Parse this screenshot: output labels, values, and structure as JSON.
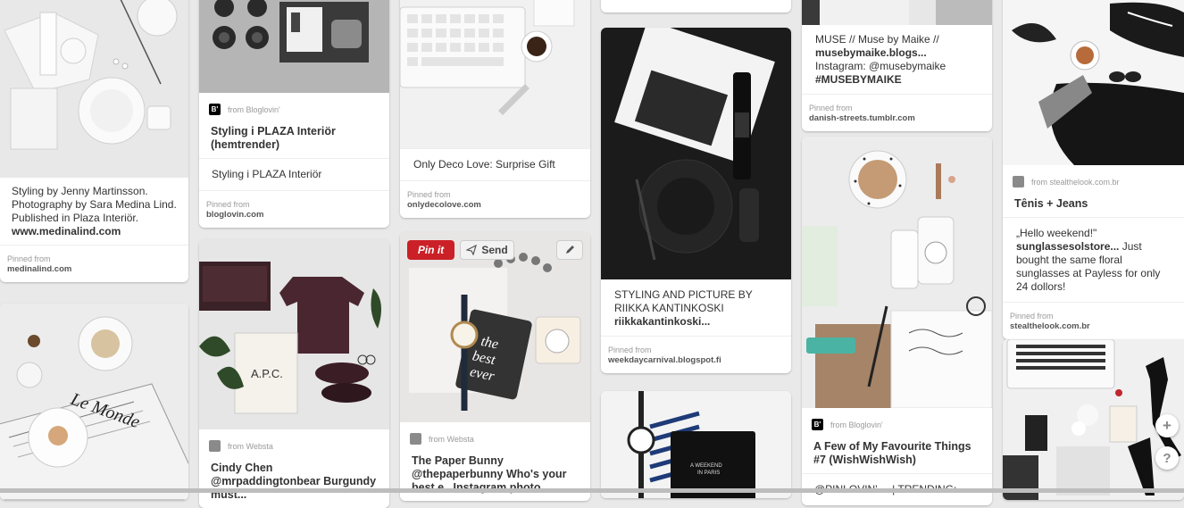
{
  "pins": {
    "p1": {
      "description": "Styling by Jenny Martinsson. Photography by Sara Medina Lind. Published in Plaza Interiör.",
      "link": "www.medinalind.com",
      "pinned_label": "Pinned from",
      "pinned_source": "medinalind.com"
    },
    "p3": {
      "from": "from Bloglovin'",
      "title": "Styling i PLAZA Interiör (hemtrender)",
      "sub": "Styling i PLAZA Interiör",
      "pinned_label": "Pinned from",
      "pinned_source": "bloglovin.com"
    },
    "p4": {
      "from": "from Websta",
      "title": "Cindy Chen @mrpaddingtonbear Burgundy must..."
    },
    "p5": {
      "sub": "Only Deco Love: Surprise Gift",
      "pinned_label": "Pinned from",
      "pinned_source": "onlydecolove.com"
    },
    "p6": {
      "pinit": "Pin it",
      "send": "Send",
      "from": "from Websta",
      "title": "The Paper Bunny @thepaperbunny Who's your best e...Instagram photo"
    },
    "p8": {
      "description": "STYLING AND PICTURE BY RIIKKA KANTINKOSKI",
      "bold": "riikkakantinkoski...",
      "pinned_label": "Pinned from",
      "pinned_source": "weekdaycarnival.blogspot.fi"
    },
    "p10": {
      "desc1": "MUSE // Muse by Maike //",
      "bold1": "musebymaike.blogs...",
      "desc2": " Instagram: @musebymaike",
      "bold2": "#MUSEBYMAIKE",
      "pinned_label": "Pinned from",
      "pinned_source": "danish-streets.tumblr.com"
    },
    "p11": {
      "from": "from Bloglovin'",
      "title": "A Few of My Favourite Things #7 (WishWishWish)",
      "sub": "@PINLOVIN' ... | TRENDING:"
    },
    "p12": {
      "from": "from stealthelook.com.br",
      "title": "Tênis + Jeans",
      "desc1": "„Hello weekend!\"",
      "bold1": "sunglassesolstore...",
      "desc2": " Just bought the same floral sunglasses at Payless for only 24 dollors!",
      "pinned_label": "Pinned from",
      "pinned_source": "stealthelook.com.br"
    }
  },
  "floating": {
    "plus": "+",
    "help": "?"
  },
  "icons": {
    "bloglovin": "B'",
    "edit": "pencil-icon",
    "send": "paper-plane-icon"
  }
}
